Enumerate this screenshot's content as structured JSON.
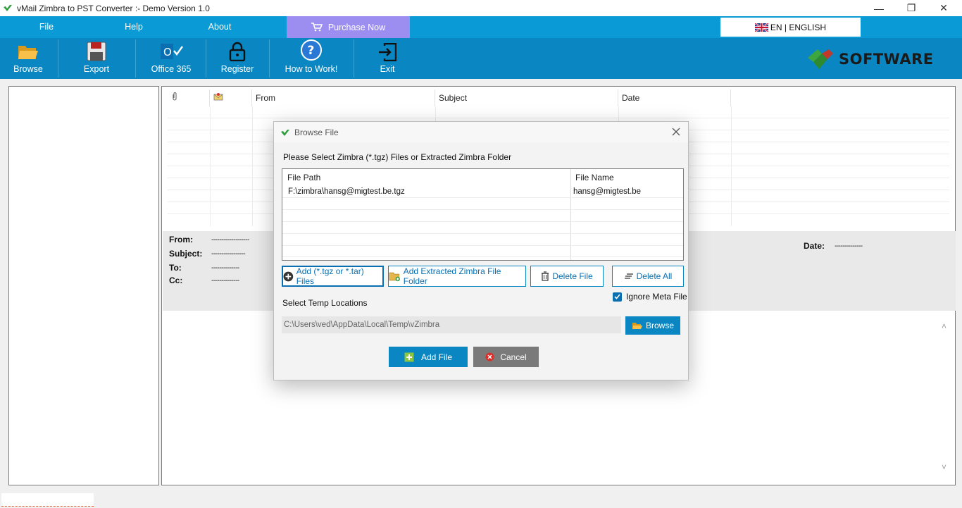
{
  "window": {
    "title": "vMail Zimbra to PST Converter  :- Demo Version 1.0",
    "minimize": "—",
    "restore": "❐",
    "close": "✕"
  },
  "menu": {
    "file": "File",
    "help": "Help",
    "about": "About",
    "purchase": "Purchase Now",
    "language": "EN | ENGLISH"
  },
  "toolbar": {
    "browse": "Browse",
    "export": "Export",
    "office365": "Office 365",
    "register": "Register",
    "how_to_work": "How to Work!",
    "exit": "Exit",
    "brand": "SOFTWARE"
  },
  "grid": {
    "columns": [
      "",
      "",
      "From",
      "Subject",
      "Date"
    ]
  },
  "details": {
    "from_label": "From:",
    "from_value": "-------------------",
    "subject_label": "Subject:",
    "subject_value": "-----------------",
    "to_label": "To:",
    "to_value": "--------------",
    "cc_label": "Cc:",
    "cc_value": "--------------",
    "date_label": "Date:",
    "date_value": "--------------"
  },
  "dialog": {
    "title": "Browse File",
    "instruction": "Please Select Zimbra (*.tgz) Files or Extracted Zimbra Folder",
    "columns": {
      "path": "File Path",
      "name": "File Name"
    },
    "files": [
      {
        "path": "F:\\zimbra\\hansg@migtest.be.tgz",
        "name": "hansg@migtest.be"
      }
    ],
    "add_files": "Add (*.tgz or *.tar) Files",
    "add_folder": "Add Extracted Zimbra File Folder",
    "delete_file": "Delete File",
    "delete_all": "Delete All",
    "ignore_meta": "Ignore Meta File",
    "ignore_meta_checked": true,
    "temp_label": "Select Temp Locations",
    "temp_path": "C:\\Users\\ved\\AppData\\Local\\Temp\\vZimbra",
    "browse": "Browse",
    "add_file": "Add File",
    "cancel": "Cancel"
  },
  "colors": {
    "menubar": "#0a9ad6",
    "toolbar": "#0a87c2",
    "purchase": "#9b8ef0",
    "accent": "#0a6fb0"
  }
}
